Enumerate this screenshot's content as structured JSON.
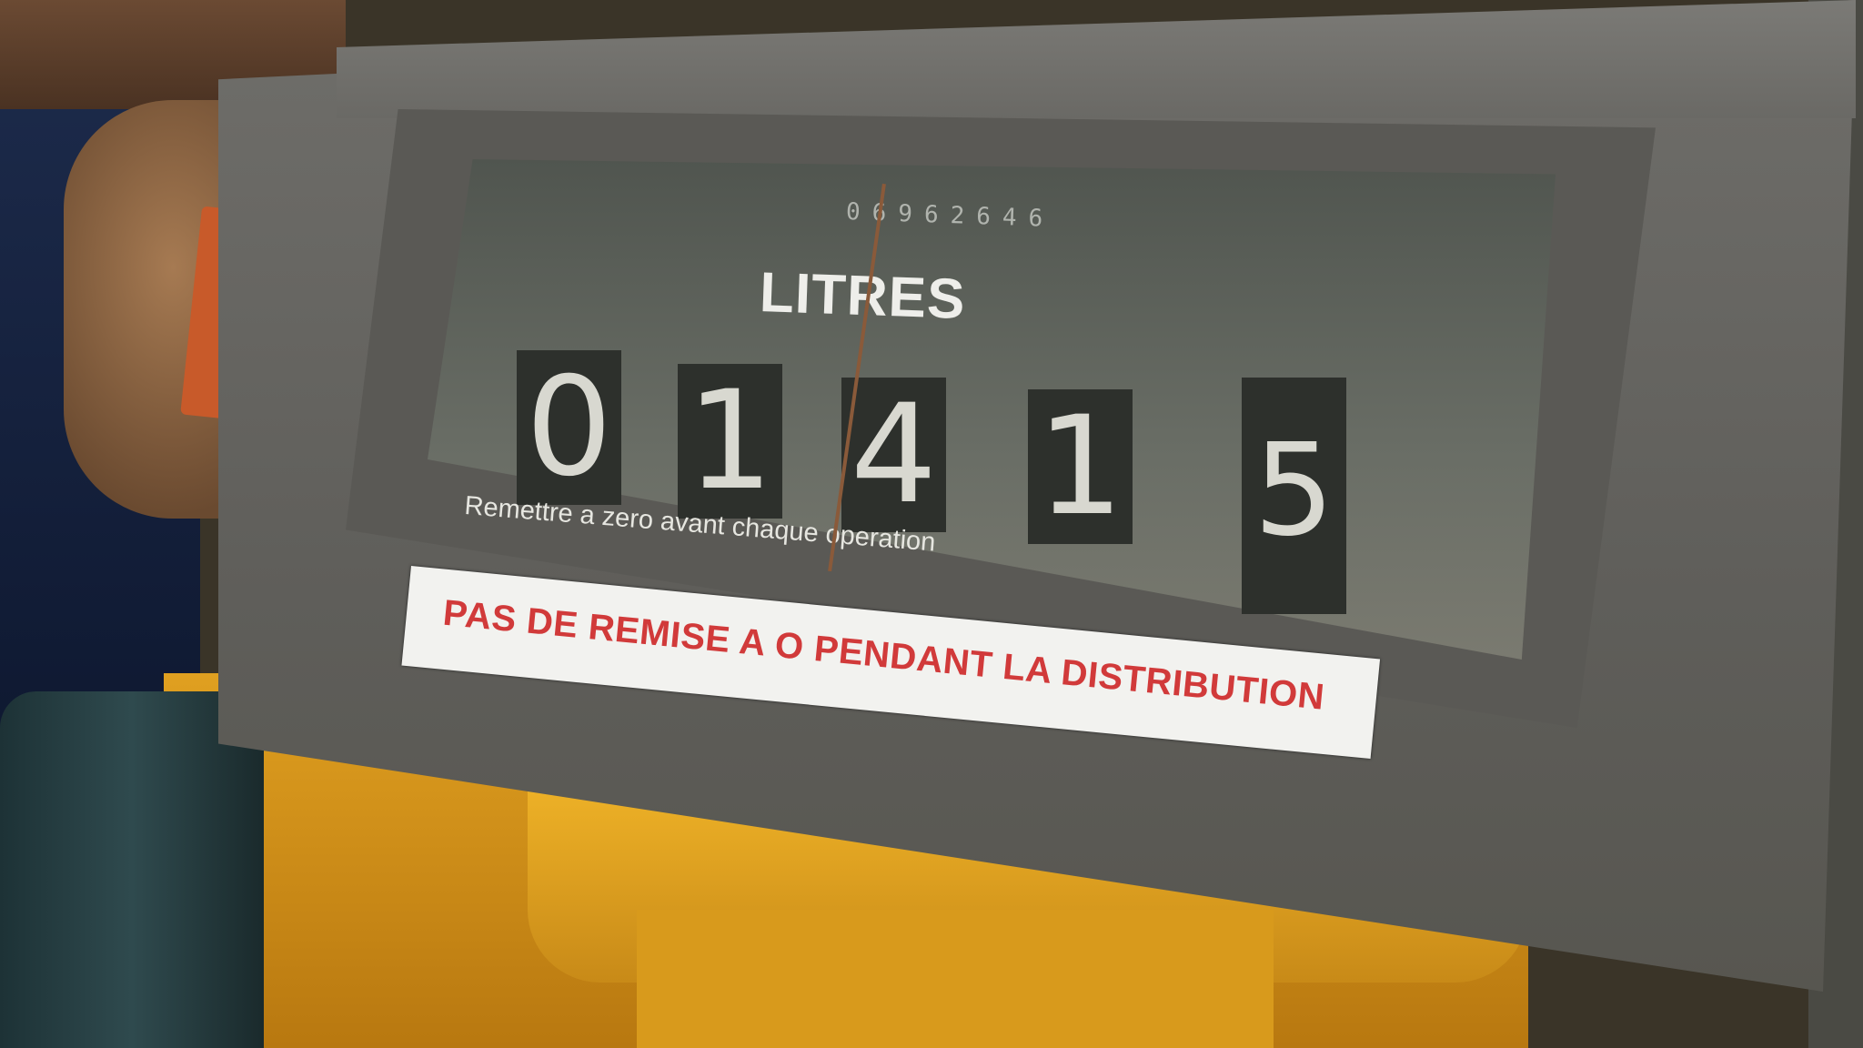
{
  "meter": {
    "totalizer": "06962646",
    "unit_label": "LITRES",
    "digits": [
      "0",
      "1",
      "4",
      "1",
      "5"
    ],
    "instruction": "Remettre a zero avant chaque operation",
    "warning_label": "PAS DE REMISE A O PENDANT LA DISTRIBUTION"
  },
  "colors": {
    "housing": "#6a6965",
    "warning_text": "#d13a3a",
    "body_yellow": "#e0a020"
  }
}
